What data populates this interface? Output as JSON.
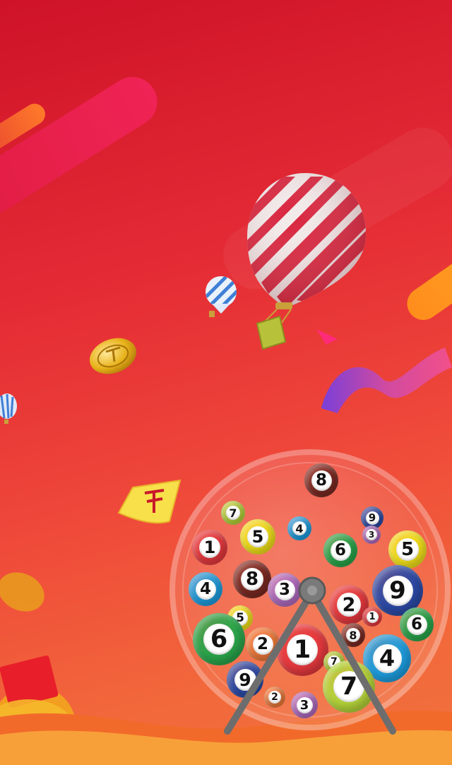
{
  "scene": {
    "palette": {
      "bg_top": "#cf1228",
      "bg_bottom": "#f0713e",
      "streak_pink": "#f01a4e",
      "streak_orange": "#ff8a1c",
      "balloon_red": "#d8243d",
      "coin_gold": "#e8b21b"
    },
    "balls": [
      {
        "n": "8",
        "c": "#7a2a22"
      },
      {
        "n": "7",
        "c": "#b5d43a"
      },
      {
        "n": "5",
        "c": "#f3e21a"
      },
      {
        "n": "4",
        "c": "#1e9ee0"
      },
      {
        "n": "9",
        "c": "#2b4aa6"
      },
      {
        "n": "3",
        "c": "#b06cc0"
      },
      {
        "n": "1",
        "c": "#e6393e"
      },
      {
        "n": "6",
        "c": "#2aa64b"
      },
      {
        "n": "5",
        "c": "#f3e21a"
      },
      {
        "n": "4",
        "c": "#1e9ee0"
      },
      {
        "n": "8",
        "c": "#7a2a22"
      },
      {
        "n": "3",
        "c": "#b06cc0"
      },
      {
        "n": "2",
        "c": "#e6393e"
      },
      {
        "n": "9",
        "c": "#2b4aa6"
      },
      {
        "n": "5",
        "c": "#f3e21a"
      },
      {
        "n": "1",
        "c": "#e6393e"
      },
      {
        "n": "8",
        "c": "#7a2a22"
      },
      {
        "n": "6",
        "c": "#2aa64b"
      },
      {
        "n": "2",
        "c": "#ef7a3a"
      },
      {
        "n": "1",
        "c": "#e6393e"
      },
      {
        "n": "7",
        "c": "#b5d43a"
      },
      {
        "n": "4",
        "c": "#1e9ee0"
      },
      {
        "n": "6",
        "c": "#2aa64b"
      },
      {
        "n": "9",
        "c": "#2b4aa6"
      },
      {
        "n": "7",
        "c": "#b5d43a"
      },
      {
        "n": "2",
        "c": "#ef7a3a"
      },
      {
        "n": "3",
        "c": "#b06cc0"
      }
    ],
    "icons": {
      "balloon": "hot-air-balloon-icon",
      "coin": "gold-coin-icon",
      "ticket": "lottery-ticket-icon",
      "envelope": "red-envelope-icon",
      "ribbon": "ribbon-icon"
    }
  }
}
